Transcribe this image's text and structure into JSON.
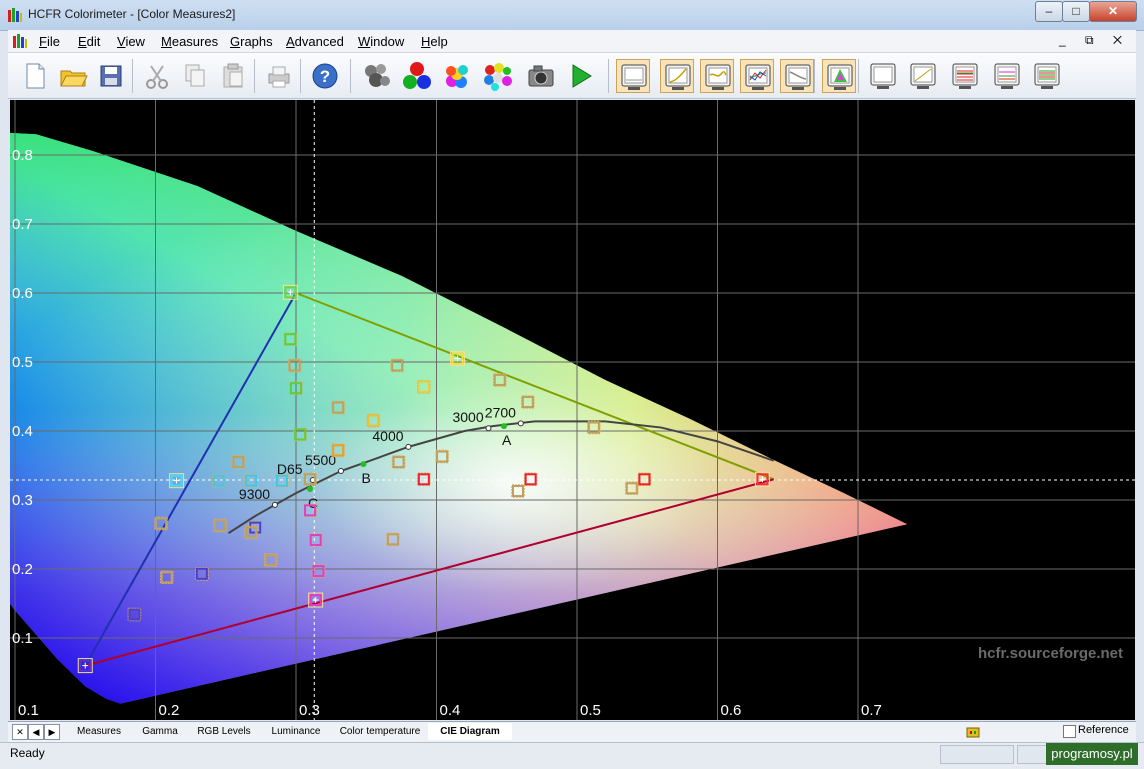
{
  "window": {
    "title": "HCFR Colorimeter - [Color Measures2]",
    "min": "–",
    "max": "□",
    "close": "✕"
  },
  "menu": [
    {
      "key": "F",
      "rest": "ile"
    },
    {
      "key": "E",
      "rest": "dit"
    },
    {
      "key": "V",
      "rest": "iew"
    },
    {
      "key": "M",
      "rest": "easures"
    },
    {
      "key": "G",
      "rest": "raphs"
    },
    {
      "key": "A",
      "rest": "dvanced"
    },
    {
      "key": "W",
      "rest": "indow"
    },
    {
      "key": "H",
      "rest": "elp"
    }
  ],
  "mdi_buttons": "_ ⧉ ✕",
  "toolbar": {
    "icons": [
      "new-document-icon",
      "open-folder-icon",
      "save-icon",
      "cut-icon",
      "copy-icon",
      "paste-icon",
      "print-icon",
      "help-icon",
      "sensor-icon",
      "rgb-balls-icon",
      "color-balls-icon",
      "multi-color-icon",
      "camera-icon",
      "play-icon",
      "view-measures-icon",
      "view-gamma-icon",
      "view-rgb-levels-icon",
      "view-luminance-icon",
      "view-color-temperature-icon",
      "view-cie-diagram-icon",
      "view-extra1-icon",
      "view-extra2-icon",
      "view-extra3-icon",
      "view-extra4-icon",
      "view-extra5-icon"
    ]
  },
  "chart_data": {
    "type": "scatter",
    "x_ticks": [
      "0.1",
      "0.2",
      "0.3",
      "0.4",
      "0.5",
      "0.6",
      "0.7"
    ],
    "y_ticks": [
      "0.8",
      "0.7",
      "0.6",
      "0.5",
      "0.4",
      "0.3",
      "0.2",
      "0.1"
    ],
    "xlim": [
      0.0,
      0.8
    ],
    "ylim": [
      0.0,
      0.85
    ],
    "grid": true,
    "crosshair": {
      "x": 0.313,
      "y": 0.329
    },
    "watermark": "hcfr.sourceforge.net",
    "reference_gamut": [
      [
        0.64,
        0.33
      ],
      [
        0.3,
        0.6
      ],
      [
        0.15,
        0.06
      ]
    ],
    "primaries": [
      {
        "name": "red",
        "x": 0.632,
        "y": 0.33,
        "color": "#ff2a3a"
      },
      {
        "name": "green",
        "x": 0.296,
        "y": 0.601,
        "color": "#7bd040"
      },
      {
        "name": "blue",
        "x": 0.15,
        "y": 0.06,
        "color": "#5a30c0"
      },
      {
        "name": "yellow",
        "x": 0.415,
        "y": 0.505,
        "color": "#f5e040"
      },
      {
        "name": "cyan",
        "x": 0.215,
        "y": 0.328,
        "color": "#40e0f0"
      },
      {
        "name": "magenta",
        "x": 0.314,
        "y": 0.155,
        "color": "#e040c0"
      }
    ],
    "measurements": [
      {
        "x": 0.296,
        "y": 0.533,
        "color": "#5ad03a"
      },
      {
        "x": 0.3,
        "y": 0.462,
        "color": "#5ad03a"
      },
      {
        "x": 0.303,
        "y": 0.395,
        "color": "#5ad03a"
      },
      {
        "x": 0.299,
        "y": 0.495,
        "color": "#c0a060"
      },
      {
        "x": 0.33,
        "y": 0.434,
        "color": "#c0a060"
      },
      {
        "x": 0.372,
        "y": 0.495,
        "color": "#c0a060"
      },
      {
        "x": 0.391,
        "y": 0.464,
        "color": "#e8d040"
      },
      {
        "x": 0.355,
        "y": 0.415,
        "color": "#f0c030"
      },
      {
        "x": 0.33,
        "y": 0.372,
        "color": "#f0a020"
      },
      {
        "x": 0.445,
        "y": 0.474,
        "color": "#c0a060"
      },
      {
        "x": 0.465,
        "y": 0.442,
        "color": "#c0a060"
      },
      {
        "x": 0.373,
        "y": 0.355,
        "color": "#c0a060"
      },
      {
        "x": 0.404,
        "y": 0.363,
        "color": "#c0a060"
      },
      {
        "x": 0.391,
        "y": 0.33,
        "color": "#f02030"
      },
      {
        "x": 0.467,
        "y": 0.33,
        "color": "#f02030"
      },
      {
        "x": 0.548,
        "y": 0.33,
        "color": "#f02030"
      },
      {
        "x": 0.458,
        "y": 0.313,
        "color": "#c0a060"
      },
      {
        "x": 0.512,
        "y": 0.405,
        "color": "#c0a060"
      },
      {
        "x": 0.539,
        "y": 0.317,
        "color": "#c0a060"
      },
      {
        "x": 0.245,
        "y": 0.328,
        "color": "#40c8e8"
      },
      {
        "x": 0.268,
        "y": 0.328,
        "color": "#40c8e8"
      },
      {
        "x": 0.29,
        "y": 0.328,
        "color": "#40c8e8"
      },
      {
        "x": 0.259,
        "y": 0.355,
        "color": "#c0a060"
      },
      {
        "x": 0.246,
        "y": 0.263,
        "color": "#c0a060"
      },
      {
        "x": 0.271,
        "y": 0.26,
        "color": "#5040c0"
      },
      {
        "x": 0.233,
        "y": 0.193,
        "color": "#5040c0"
      },
      {
        "x": 0.185,
        "y": 0.134,
        "color": "#5040c0"
      },
      {
        "x": 0.268,
        "y": 0.253,
        "color": "#c0a060"
      },
      {
        "x": 0.282,
        "y": 0.213,
        "color": "#c0a060"
      },
      {
        "x": 0.204,
        "y": 0.266,
        "color": "#c0a060"
      },
      {
        "x": 0.208,
        "y": 0.188,
        "color": "#c0a060"
      },
      {
        "x": 0.31,
        "y": 0.285,
        "color": "#e040c0"
      },
      {
        "x": 0.314,
        "y": 0.242,
        "color": "#e040c0"
      },
      {
        "x": 0.316,
        "y": 0.197,
        "color": "#e040c0"
      },
      {
        "x": 0.369,
        "y": 0.243,
        "color": "#c0a060"
      },
      {
        "x": 0.31,
        "y": 0.33,
        "color": "#c0a060"
      }
    ],
    "planckian_locus": [
      [
        0.252,
        0.252
      ],
      [
        0.272,
        0.278
      ],
      [
        0.285,
        0.293
      ],
      [
        0.3,
        0.31
      ],
      [
        0.332,
        0.342
      ],
      [
        0.35,
        0.355
      ],
      [
        0.38,
        0.377
      ],
      [
        0.42,
        0.4
      ],
      [
        0.44,
        0.407
      ],
      [
        0.47,
        0.414
      ],
      [
        0.52,
        0.414
      ],
      [
        0.56,
        0.405
      ],
      [
        0.6,
        0.385
      ],
      [
        0.64,
        0.357
      ]
    ],
    "locus_labels": [
      {
        "text": "9300",
        "x": 0.285,
        "y": 0.293
      },
      {
        "text": "D65",
        "x": 0.312,
        "y": 0.329
      },
      {
        "text": "5500",
        "x": 0.332,
        "y": 0.342
      },
      {
        "text": "4000",
        "x": 0.38,
        "y": 0.377
      },
      {
        "text": "3000",
        "x": 0.437,
        "y": 0.404
      },
      {
        "text": "2700",
        "x": 0.46,
        "y": 0.411
      }
    ],
    "illuminants": [
      {
        "text": "A",
        "x": 0.448,
        "y": 0.407
      },
      {
        "text": "B",
        "x": 0.348,
        "y": 0.352
      },
      {
        "text": "C",
        "x": 0.31,
        "y": 0.316
      }
    ]
  },
  "tabs": [
    "Measures",
    "Gamma",
    "RGB Levels",
    "Luminance",
    "Color temperature",
    "CIE Diagram"
  ],
  "active_tab": "CIE Diagram",
  "reference_label": "Reference",
  "status": "Ready",
  "watermark_badge": "programosy.pl"
}
